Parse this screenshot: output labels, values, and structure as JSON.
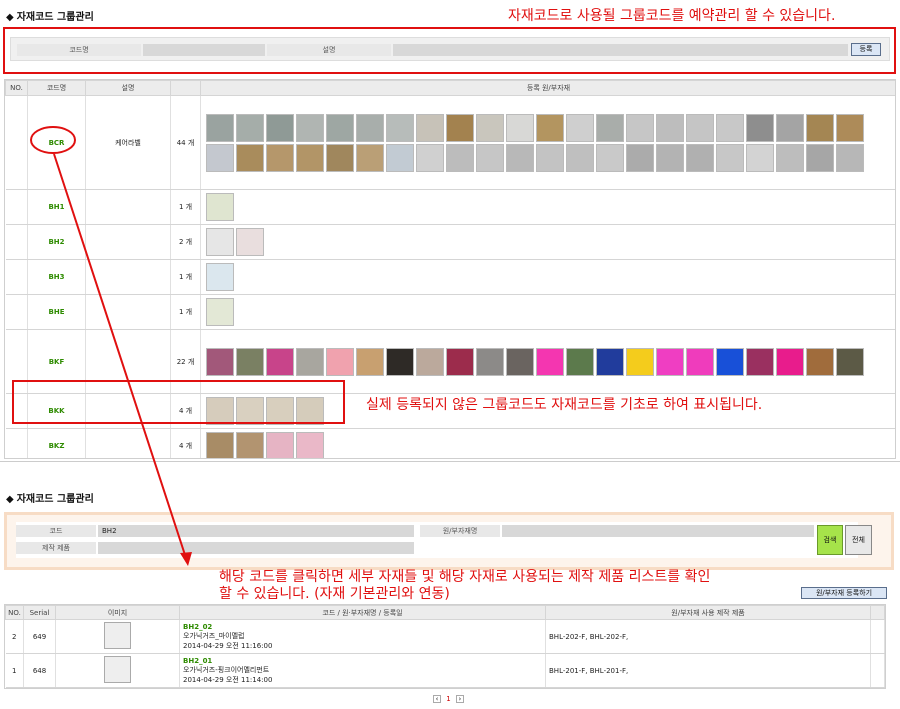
{
  "top": {
    "title": "자재코드 그룹관리",
    "note": "자재코드로 사용될 그룹코드를 예약관리 할 수 있습니다.",
    "form": {
      "code_label": "코드명",
      "desc_label": "설명",
      "register_btn": "등록"
    },
    "headers": {
      "no": "NO.",
      "code": "코드명",
      "desc": "설명",
      "items": "등록 원/부자재"
    },
    "rows": [
      {
        "code": "BCR",
        "desc": "케어라벨",
        "count": "44 개",
        "thumbs": [
          "#9aa3a0",
          "#a5ada9",
          "#8f9a96",
          "#b0b5b2",
          "#9ea7a3",
          "#a8aeab",
          "#b7bcba",
          "#c7c2b8",
          "#a3824f",
          "#c9c6bd",
          "#d8d8d6",
          "#b39560",
          "#cfcfcf",
          "#a9adaa",
          "#c6c6c6",
          "#bdbdbd",
          "#c5c5c5",
          "#c8c8c8",
          "#8e8e8e",
          "#a4a4a4",
          "#a48653",
          "#ad8b59",
          "#c4c8cf",
          "#a98c5c",
          "#b5976b",
          "#b29567",
          "#a0875d",
          "#ba9f76",
          "#c2cbd3",
          "#d0d0d0",
          "#bcbcbc",
          "#c6c6c6",
          "#b8b8b8",
          "#c3c3c3",
          "#bfbfbf",
          "#c9c9c9",
          "#ababab",
          "#b3b3b3",
          "#b0b0b0",
          "#c7c7c7",
          "#d3d3d3",
          "#bdbdbd",
          "#a6a6a6",
          "#b7b7b7"
        ]
      },
      {
        "code": "BH1",
        "desc": "",
        "count": "1 개",
        "thumbs": [
          "#dfe5d0"
        ]
      },
      {
        "code": "BH2",
        "desc": "",
        "count": "2 개",
        "thumbs": [
          "#e6e6e6",
          "#e9dede"
        ]
      },
      {
        "code": "BH3",
        "desc": "",
        "count": "1 개",
        "thumbs": [
          "#dbe7ee"
        ]
      },
      {
        "code": "BHE",
        "desc": "",
        "count": "1 개",
        "thumbs": [
          "#e3e8d6"
        ]
      },
      {
        "code": "BKF",
        "desc": "",
        "count": "22 개",
        "thumbs": [
          "#a2587a",
          "#7a8063",
          "#c8448a",
          "#a8a69f",
          "#f0a2ae",
          "#c8a070",
          "#2e2a26",
          "#bba99c",
          "#9c2c4c",
          "#8c8a88",
          "#6a6460",
          "#f436b0",
          "#5c7a4c",
          "#213c9c",
          "#f4cc1c",
          "#ef3ec2",
          "#ef3cbc",
          "#1850d8",
          "#9a3060",
          "#e81c8c",
          "#a06c3c",
          "#5c5a46"
        ]
      },
      {
        "code": "BKK",
        "desc": "",
        "count": "4 개",
        "thumbs": [
          "#d6ccbc",
          "#d9d0c0",
          "#d8cfbe",
          "#d5ccbb"
        ]
      },
      {
        "code": "BKZ",
        "desc": "",
        "count": "4 개",
        "thumbs": [
          "#a88c66",
          "#b29470",
          "#e6b4c4",
          "#eab8c8"
        ]
      }
    ]
  },
  "note_mid": "실제 등록되지 않은 그룹코드도 자재코드를 기초로 하여 표시됩니다.",
  "bottom": {
    "title": "자재코드 그룹관리",
    "form": {
      "code_label": "코드",
      "code_value": "BH2",
      "material_label": "원/부자재명",
      "product_label": "제작 제품",
      "search_btn": "검색",
      "all_btn": "전체"
    },
    "note_line1": "해당 코드를 클릭하면 세부 자재들 및 해당 자재로 사용되는 제작 제품 리스트를 확인",
    "note_line2": "할 수 있습니다. (자재 기본관리와 연동)",
    "register_btn": "원/부자재 등록하기",
    "headers": {
      "no": "NO.",
      "serial": "Serial",
      "image": "이미지",
      "info": "코드 / 원·부자재명 / 등록일",
      "products": "원/부자재 사용 제작 제품"
    },
    "rows": [
      {
        "no": "2",
        "serial": "649",
        "code": "BH2_02",
        "name": "오가닉거즈_마이멜럽",
        "date": "2014-04-29 오전 11:16:00",
        "products": "BHL-202-F, BHL-202-F,"
      },
      {
        "no": "1",
        "serial": "648",
        "code": "BH2_01",
        "name": "오가닉거즈-핑크이어멜리펀트",
        "date": "2014-04-29 오전 11:14:00",
        "products": "BHL-201-F, BHL-201-F,"
      }
    ],
    "page": "1"
  }
}
